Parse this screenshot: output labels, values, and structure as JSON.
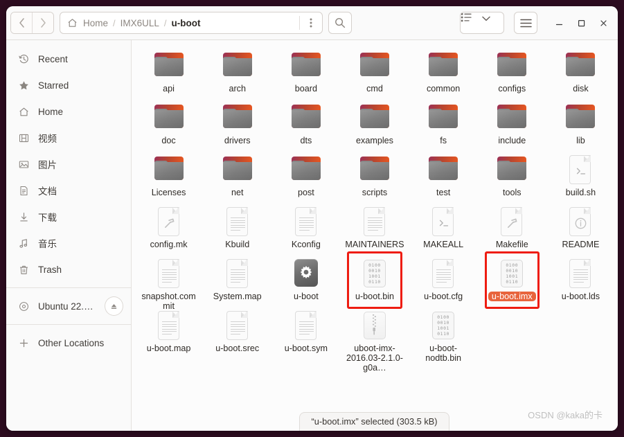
{
  "window": {
    "nav": {
      "back": "‹",
      "forward": "›"
    },
    "breadcrumb": [
      "Home",
      "IMX6ULL",
      "u-boot"
    ],
    "separator": "/",
    "controls": {
      "minimize": "–",
      "maximize": "□",
      "close": "✕"
    }
  },
  "sidebar": {
    "items": [
      {
        "label": "Recent",
        "icon": "clock-icon"
      },
      {
        "label": "Starred",
        "icon": "star-icon"
      },
      {
        "label": "Home",
        "icon": "home-icon"
      },
      {
        "label": "视频",
        "icon": "video-icon"
      },
      {
        "label": "图片",
        "icon": "pictures-icon"
      },
      {
        "label": "文档",
        "icon": "documents-icon"
      },
      {
        "label": "下载",
        "icon": "downloads-icon"
      },
      {
        "label": "音乐",
        "icon": "music-icon"
      },
      {
        "label": "Trash",
        "icon": "trash-icon"
      }
    ],
    "devices": [
      {
        "label": "Ubuntu 22.0…",
        "icon": "disc-icon",
        "eject": "⏏"
      }
    ],
    "other": {
      "label": "Other Locations",
      "icon": "plus-icon"
    }
  },
  "files": [
    {
      "name": "api",
      "type": "folder"
    },
    {
      "name": "arch",
      "type": "folder"
    },
    {
      "name": "board",
      "type": "folder"
    },
    {
      "name": "cmd",
      "type": "folder"
    },
    {
      "name": "common",
      "type": "folder"
    },
    {
      "name": "configs",
      "type": "folder"
    },
    {
      "name": "disk",
      "type": "folder"
    },
    {
      "name": "doc",
      "type": "folder"
    },
    {
      "name": "drivers",
      "type": "folder"
    },
    {
      "name": "dts",
      "type": "folder"
    },
    {
      "name": "examples",
      "type": "folder"
    },
    {
      "name": "fs",
      "type": "folder"
    },
    {
      "name": "include",
      "type": "folder"
    },
    {
      "name": "lib",
      "type": "folder"
    },
    {
      "name": "Licenses",
      "type": "folder"
    },
    {
      "name": "net",
      "type": "folder"
    },
    {
      "name": "post",
      "type": "folder"
    },
    {
      "name": "scripts",
      "type": "folder"
    },
    {
      "name": "test",
      "type": "folder"
    },
    {
      "name": "tools",
      "type": "folder"
    },
    {
      "name": "build.sh",
      "type": "script"
    },
    {
      "name": "config.mk",
      "type": "makefile"
    },
    {
      "name": "Kbuild",
      "type": "text"
    },
    {
      "name": "Kconfig",
      "type": "text"
    },
    {
      "name": "MAINTAINERS",
      "type": "text"
    },
    {
      "name": "MAKEALL",
      "type": "script"
    },
    {
      "name": "Makefile",
      "type": "makefile"
    },
    {
      "name": "README",
      "type": "readme"
    },
    {
      "name": "snapshot.commit",
      "type": "text"
    },
    {
      "name": "System.map",
      "type": "text"
    },
    {
      "name": "u-boot",
      "type": "executable"
    },
    {
      "name": "u-boot.bin",
      "type": "binary",
      "highlighted": true
    },
    {
      "name": "u-boot.cfg",
      "type": "text"
    },
    {
      "name": "u-boot.imx",
      "type": "binary",
      "highlighted": true,
      "selected": true
    },
    {
      "name": "u-boot.lds",
      "type": "text"
    },
    {
      "name": "u-boot.map",
      "type": "text"
    },
    {
      "name": "u-boot.srec",
      "type": "text"
    },
    {
      "name": "u-boot.sym",
      "type": "text"
    },
    {
      "name": "uboot-imx-2016.03-2.1.0-g0a…",
      "type": "archive"
    },
    {
      "name": "u-boot-nodtb.bin",
      "type": "binary"
    }
  ],
  "binary_icon_rows": [
    "0100",
    "0010",
    "1001",
    "0110"
  ],
  "statusbar": {
    "text": "“u-boot.imx” selected (303.5 kB)"
  },
  "watermark": {
    "text": "OSDN @kaka的卡"
  },
  "colors": {
    "desktop": "#2d0c20",
    "selection": "#e8643c",
    "highlight_box": "#ee1c11",
    "folder_orange": "#f05a1e",
    "folder_aubergine": "#9b3156"
  }
}
